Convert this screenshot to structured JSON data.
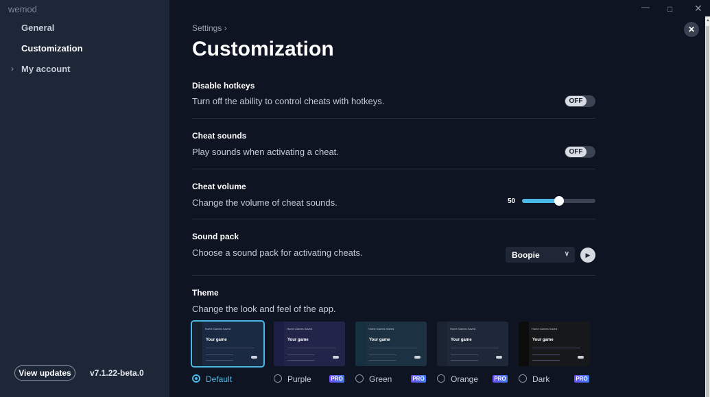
{
  "app": {
    "name": "wemod"
  },
  "sidebar": {
    "items": [
      {
        "label": "General"
      },
      {
        "label": "Customization"
      },
      {
        "label": "My account"
      }
    ],
    "view_updates": "View updates",
    "version": "v7.1.22-beta.0"
  },
  "header": {
    "breadcrumb": "Settings",
    "title": "Customization"
  },
  "settings": {
    "disable_hotkeys": {
      "title": "Disable hotkeys",
      "description": "Turn off the ability to control cheats with hotkeys.",
      "toggle": "OFF"
    },
    "cheat_sounds": {
      "title": "Cheat sounds",
      "description": "Play sounds when activating a cheat.",
      "toggle": "OFF"
    },
    "cheat_volume": {
      "title": "Cheat volume",
      "description": "Change the volume of cheat sounds.",
      "value": "50",
      "level": 0.5
    },
    "sound_pack": {
      "title": "Sound pack",
      "description": "Choose a sound pack for activating cheats.",
      "selected": "Boopie"
    },
    "theme": {
      "title": "Theme",
      "description": "Change the look and feel of the app.",
      "options": [
        {
          "label": "Default",
          "pro": "",
          "selected": true,
          "color": "#1a2a42",
          "side": "#16202e"
        },
        {
          "label": "Purple",
          "pro": "PRO",
          "selected": false,
          "color": "#23244a",
          "side": "#1d1e44"
        },
        {
          "label": "Green",
          "pro": "PRO",
          "selected": false,
          "color": "#1c3242",
          "side": "#173040"
        },
        {
          "label": "Orange",
          "pro": "PRO",
          "selected": false,
          "color": "#1e2838",
          "side": "#1c2330"
        },
        {
          "label": "Dark",
          "pro": "PRO",
          "selected": false,
          "color": "#161819",
          "side": "#0c0c0c"
        }
      ],
      "preview": {
        "nav": [
          "Home",
          "Games",
          "Saved"
        ],
        "game": "Your game"
      }
    }
  },
  "colors": {
    "accent": "#4cb8e8",
    "background": "#0f1422",
    "sidebar": "#1d2738"
  },
  "icons": {
    "close": "close-icon",
    "play": "play-icon",
    "chevron": "chevron-down-icon"
  }
}
